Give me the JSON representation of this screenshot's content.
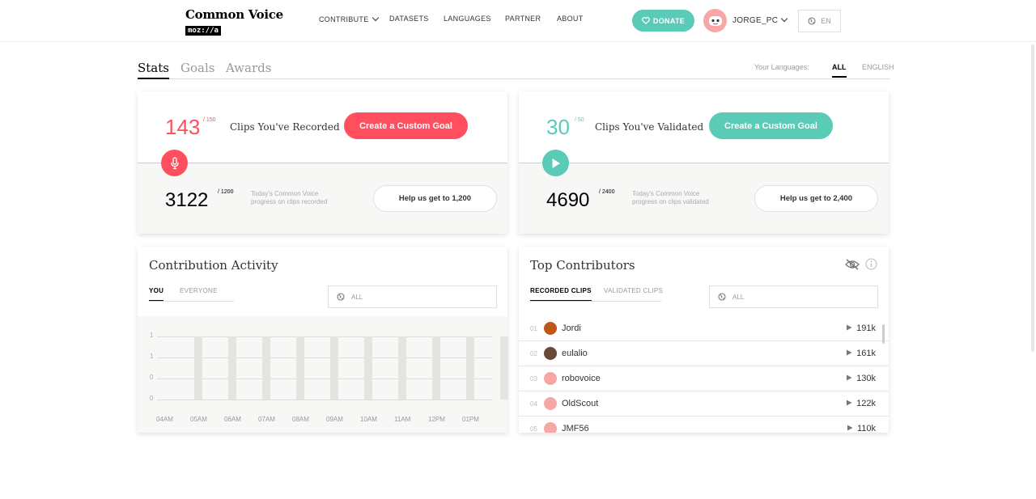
{
  "header": {
    "logo_title": "Common Voice",
    "logo_sub": "moz://a",
    "nav": [
      "CONTRIBUTE",
      "DATASETS",
      "LANGUAGES",
      "PARTNER",
      "ABOUT"
    ],
    "donate_label": "DONATE",
    "username": "JORGE_PC",
    "locale": "EN"
  },
  "tabs": {
    "items": [
      "Stats",
      "Goals",
      "Awards"
    ],
    "active": "Stats",
    "your_languages_label": "Your Languages:",
    "language_options": [
      "ALL",
      "ENGLISH"
    ]
  },
  "record_card": {
    "count": "143",
    "goal": "/ 150",
    "label": "Clips You've Recorded",
    "button": "Create a Custom Goal",
    "today_count": "3122",
    "today_goal": "/ 1200",
    "today_text_1": "Today's Common Voice",
    "today_text_2": "progress on clips recorded",
    "help_button": "Help us get to 1,200",
    "accent": "#ff4f5e"
  },
  "validate_card": {
    "count": "30",
    "goal": "/ 50",
    "label": "Clips You've Validated",
    "button": "Create a Custom Goal",
    "today_count": "4690",
    "today_goal": "/ 2400",
    "today_text_1": "Today's Common Voice",
    "today_text_2": "progress on clips validated",
    "help_button": "Help us get to 2,400",
    "accent": "#59cbb7"
  },
  "activity": {
    "title": "Contribution Activity",
    "subtabs": [
      "YOU",
      "EVERYONE"
    ],
    "filter": "ALL"
  },
  "chart_data": {
    "type": "bar",
    "categories": [
      "04AM",
      "05AM",
      "06AM",
      "07AM",
      "08AM",
      "09AM",
      "10AM",
      "11AM",
      "12PM",
      "01PM"
    ],
    "values": [
      0,
      0,
      0,
      0,
      0,
      0,
      0,
      0,
      0,
      0
    ],
    "y_tick_labels": [
      "1",
      "1",
      "0",
      "0"
    ],
    "title": "",
    "xlabel": "",
    "ylabel": "",
    "grid": true
  },
  "contributors": {
    "title": "Top Contributors",
    "subtabs": [
      "RECORDED CLIPS",
      "VALIDATED CLIPS"
    ],
    "filter": "ALL",
    "rows": [
      {
        "rank": "01",
        "name": "Jordi",
        "count": "191k",
        "avatar_color": "#c0561a"
      },
      {
        "rank": "02",
        "name": "eulalio",
        "count": "161k",
        "avatar_color": "#6b4a3a"
      },
      {
        "rank": "03",
        "name": "robovoice",
        "count": "130k",
        "avatar_color": "#f6a7a6"
      },
      {
        "rank": "04",
        "name": "OldScout",
        "count": "122k",
        "avatar_color": "#f6a7a6"
      },
      {
        "rank": "05",
        "name": "JMF56",
        "count": "110k",
        "avatar_color": "#f6a7a6"
      }
    ]
  }
}
